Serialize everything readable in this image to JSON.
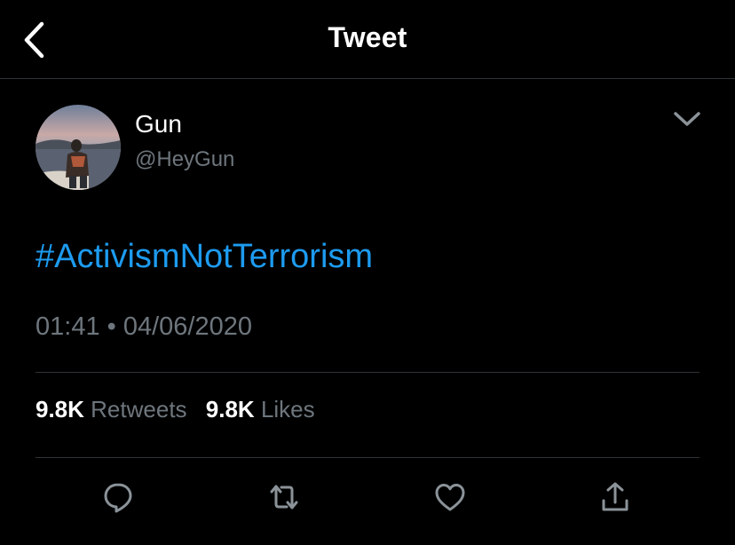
{
  "header": {
    "title": "Tweet",
    "back_icon": "back-chevron-icon"
  },
  "tweet": {
    "author": {
      "display_name": "Gun",
      "handle": "@HeyGun"
    },
    "text": "#ActivismNotTerrorism",
    "time": "01:41",
    "separator": "•",
    "date": "04/06/2020",
    "stats": {
      "retweets_count": "9.8K",
      "retweets_label": "Retweets",
      "likes_count": "9.8K",
      "likes_label": "Likes"
    }
  },
  "actions": [
    {
      "name": "reply",
      "icon": "reply-bubble-icon"
    },
    {
      "name": "retweet",
      "icon": "retweet-icon"
    },
    {
      "name": "like",
      "icon": "heart-icon"
    },
    {
      "name": "share",
      "icon": "share-icon"
    }
  ],
  "colors": {
    "background": "#000000",
    "text_primary": "#ffffff",
    "text_secondary": "#6e767d",
    "accent": "#1d9bf0",
    "divider": "#2f3336"
  }
}
